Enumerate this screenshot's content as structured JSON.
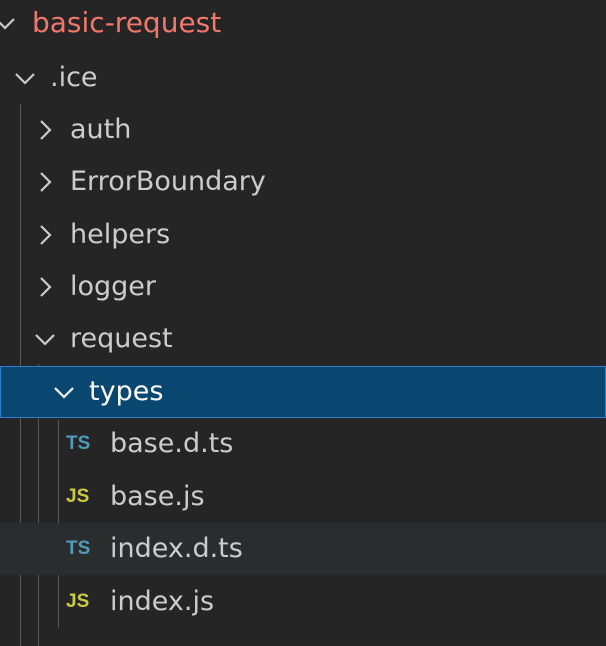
{
  "explorer": {
    "root": {
      "label": "basic-request",
      "expanded": true
    },
    "items": [
      {
        "label": ".ice",
        "type": "folder",
        "expanded": true
      },
      {
        "label": "auth",
        "type": "folder",
        "expanded": false
      },
      {
        "label": "ErrorBoundary",
        "type": "folder",
        "expanded": false
      },
      {
        "label": "helpers",
        "type": "folder",
        "expanded": false
      },
      {
        "label": "logger",
        "type": "folder",
        "expanded": false
      },
      {
        "label": "request",
        "type": "folder",
        "expanded": true
      },
      {
        "label": "types",
        "type": "folder",
        "expanded": true,
        "selected": true
      },
      {
        "label": "base.d.ts",
        "type": "file",
        "icon": "TS"
      },
      {
        "label": "base.js",
        "type": "file",
        "icon": "JS"
      },
      {
        "label": "index.d.ts",
        "type": "file",
        "icon": "TS"
      },
      {
        "label": "index.js",
        "type": "file",
        "icon": "JS"
      }
    ]
  },
  "colors": {
    "background": "#252526",
    "selection": "#094771",
    "selection_border": "#2a7fd0",
    "root_label": "#f0786a",
    "ts_icon": "#519aba",
    "js_icon": "#cbcb41",
    "text": "#cccccc"
  },
  "icons": {
    "expanded": "chevron-down-icon",
    "collapsed": "chevron-right-icon",
    "ts_file": "typescript-file-icon",
    "js_file": "javascript-file-icon"
  }
}
